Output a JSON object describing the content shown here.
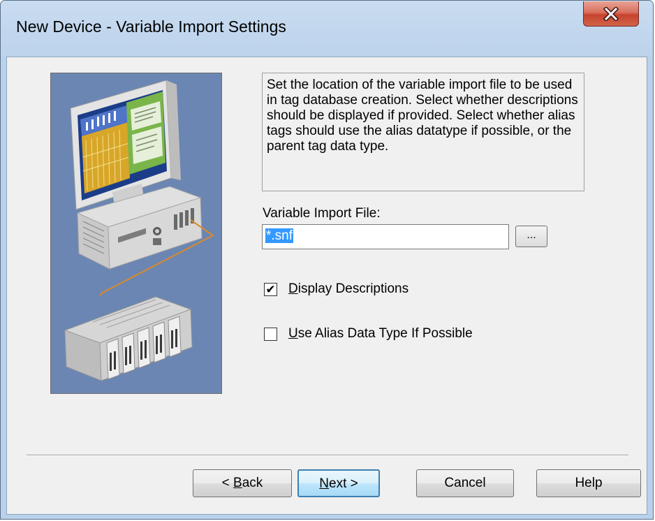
{
  "window": {
    "title": "New Device - Variable Import Settings",
    "close_icon": "close-x-icon"
  },
  "description": "Set the location of the variable import file to be used in tag database creation.  Select whether descriptions should be displayed if provided. Select whether alias tags should use the alias datatype if possible, or the parent tag data type.",
  "variable_import_file": {
    "label": "Variable Import File:",
    "value": "*.snf",
    "browse_label": "..."
  },
  "options": {
    "display_descriptions": {
      "label_mnemonic": "D",
      "label_rest": "isplay Descriptions",
      "checked": true
    },
    "use_alias_data_type": {
      "label_mnemonic": "U",
      "label_rest": "se Alias Data Type If Possible",
      "checked": false
    }
  },
  "buttons": {
    "back_prefix": "< ",
    "back_mnemonic": "B",
    "back_rest": "ack",
    "next_mnemonic": "N",
    "next_rest": "ext >",
    "cancel": "Cancel",
    "help": "Help"
  },
  "colors": {
    "window_frame": "#b9d1ea",
    "client_bg": "#f0f0f0",
    "illustration_bg": "#6b86b3",
    "close_button": "#c7432d",
    "selection": "#3399ff"
  }
}
